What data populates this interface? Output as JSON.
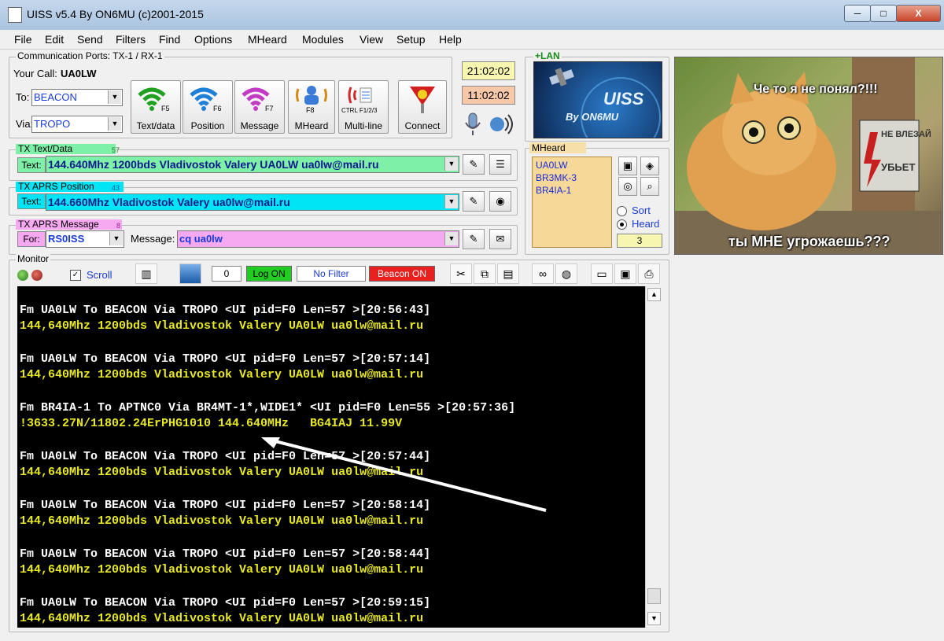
{
  "window": {
    "title": "UISS v5.4 By ON6MU (c)2001-2015",
    "controls": {
      "minimize": "─",
      "maximize": "□",
      "close": "X"
    }
  },
  "menu": [
    "File",
    "Edit",
    "Send",
    "Filters",
    "Find",
    "Options",
    "MHeard",
    "Modules",
    "View",
    "Setup",
    "Help"
  ],
  "comm": {
    "group_label": "Communication Ports: TX-1 / RX-1",
    "your_call_label": "Your Call:",
    "your_call": "UA0LW",
    "to_label": "To:",
    "to_value": "BEACON",
    "via_label": "Via:",
    "via_value": "TROPO"
  },
  "big_buttons": [
    {
      "key": "F5",
      "label": "Text/data",
      "icon": "wifi-green-icon",
      "color": "#1fa11f"
    },
    {
      "key": "F6",
      "label": "Position",
      "icon": "wifi-blue-icon",
      "color": "#1e7fd8"
    },
    {
      "key": "F7",
      "label": "Message",
      "icon": "wifi-purple-icon",
      "color": "#c33bc3"
    },
    {
      "key": "F8",
      "label": "MHeard",
      "icon": "users-icon",
      "color": "#d48a10"
    },
    {
      "key": "CTRL F1/2/3",
      "label": "Multi-line",
      "icon": "multiline-icon",
      "color": "#d02a2a"
    },
    {
      "key": "",
      "label": "Connect",
      "icon": "antenna-icon",
      "color": "#d02020"
    }
  ],
  "clocks": {
    "utc": "21:02:02",
    "local": "11:02:02",
    "utc_color": "#f6f6b0",
    "local_color": "#f6c8a8"
  },
  "lan_label": "+LAN",
  "logo": {
    "title": "UISS",
    "subtitle": "By ON6MU"
  },
  "tx_text": {
    "label": "TX Text/Data",
    "count": "57",
    "field_label": "Text:",
    "value": "144.640Mhz 1200bds Vladivostok Valery UA0LW ua0lw@mail.ru",
    "bg": "#7ff0a8"
  },
  "tx_pos": {
    "label": "TX APRS Position",
    "count": "43",
    "field_label": "Text:",
    "value": "144.660Mhz Vladivostok Valery ua0lw@mail.ru",
    "bg": "#00e5f5"
  },
  "tx_msg": {
    "label": "TX APRS Message",
    "count": "8",
    "for_label": "For:",
    "for_value": "RS0ISS",
    "msg_label": "Message:",
    "msg_value": "cq ua0lw",
    "bg": "#f6a8f0"
  },
  "mheard": {
    "label": "MHeard",
    "items": [
      "UA0LW",
      "BR3MK-3",
      "BR4IA-1"
    ],
    "sort_label": "Sort",
    "heard_label": "Heard",
    "count": "3"
  },
  "meme": {
    "top_text": "Че то я не понял?!!!",
    "sign1": "НЕ ВЛЕЗАЙ",
    "sign2": "УБЬЕТ",
    "bottom_text": "ты МНЕ угрожаешь???"
  },
  "monitor": {
    "label": "Monitor",
    "scroll_label": "Scroll",
    "counter": "0",
    "log_btn": "Log ON",
    "filter_btn": "No Filter",
    "beacon_btn": "Beacon ON",
    "lines": [
      {
        "t": "Fm UA0LW To BEACON Via TROPO <UI pid=F0 Len=57 >[20:56:43]",
        "c": "w"
      },
      {
        "t": "144,640Mhz 1200bds Vladivostok Valery UA0LW ua0lw@mail.ru",
        "c": "y"
      },
      {
        "t": "Fm UA0LW To BEACON Via TROPO <UI pid=F0 Len=57 >[20:57:14]",
        "c": "w"
      },
      {
        "t": "144,640Mhz 1200bds Vladivostok Valery UA0LW ua0lw@mail.ru",
        "c": "y"
      },
      {
        "t": "Fm BR4IA-1 To APTNC0 Via BR4MT-1*,WIDE1* <UI pid=F0 Len=55 >[20:57:36]",
        "c": "w"
      },
      {
        "t": "!3633.27N/11802.24ErPHG1010 144.640MHz   BG4IAJ 11.99V",
        "c": "y"
      },
      {
        "t": "Fm UA0LW To BEACON Via TROPO <UI pid=F0 Len=57 >[20:57:44]",
        "c": "w"
      },
      {
        "t": "144,640Mhz 1200bds Vladivostok Valery UA0LW ua0lw@mail.ru",
        "c": "y"
      },
      {
        "t": "Fm UA0LW To BEACON Via TROPO <UI pid=F0 Len=57 >[20:58:14]",
        "c": "w"
      },
      {
        "t": "144,640Mhz 1200bds Vladivostok Valery UA0LW ua0lw@mail.ru",
        "c": "y"
      },
      {
        "t": "Fm UA0LW To BEACON Via TROPO <UI pid=F0 Len=57 >[20:58:44]",
        "c": "w"
      },
      {
        "t": "144,640Mhz 1200bds Vladivostok Valery UA0LW ua0lw@mail.ru",
        "c": "y"
      },
      {
        "t": "Fm UA0LW To BEACON Via TROPO <UI pid=F0 Len=57 >[20:59:15]",
        "c": "w"
      },
      {
        "t": "144,640Mhz 1200bds Vladivostok Valery UA0LW ua0lw@mail.ru",
        "c": "y"
      }
    ]
  }
}
